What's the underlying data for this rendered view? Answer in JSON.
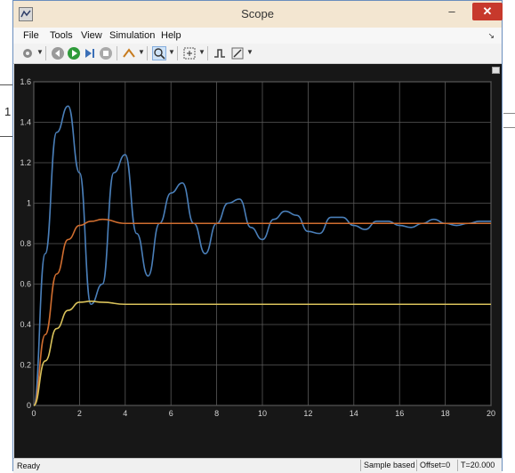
{
  "background": {
    "left_label": "1"
  },
  "window": {
    "title": "Scope",
    "minimize": "–",
    "maximize": "□",
    "close": "✕"
  },
  "menu": [
    "File",
    "Tools",
    "View",
    "Simulation",
    "Help"
  ],
  "toolbar": {
    "icons": [
      "settings-icon",
      "step-back-icon",
      "run-icon",
      "step-forward-icon",
      "stop-icon",
      "highlight-icon",
      "zoom-icon",
      "autoscale-icon",
      "triggers-icon",
      "cursor-measurements-icon"
    ]
  },
  "statusbar": {
    "status": "Ready",
    "sample_mode": "Sample based",
    "offset": "Offset=0",
    "time": "T=20.000"
  },
  "colors": {
    "plot_bg": "#000000",
    "grid": "#5a5a5a",
    "axis_text": "#d6d6d6",
    "series": [
      "#4a7fb9",
      "#cf6d2f",
      "#d9c25b"
    ]
  },
  "chart_data": {
    "type": "line",
    "xlim": [
      0,
      20
    ],
    "ylim": [
      0,
      1.6
    ],
    "xticks": [
      0,
      2,
      4,
      6,
      8,
      10,
      12,
      14,
      16,
      18,
      20
    ],
    "yticks": [
      0,
      0.2,
      0.4,
      0.6,
      0.8,
      1,
      1.2,
      1.4,
      1.6
    ],
    "ytick_labels": [
      "0",
      "0.2",
      "0.4",
      "0.6",
      "0.8",
      "1",
      "1.2",
      "1.4",
      "1.6"
    ],
    "grid": true,
    "series": [
      {
        "x": [
          0,
          0.5,
          1,
          1.5,
          2,
          2.5,
          3,
          3.5,
          4,
          4.5,
          5,
          5.5,
          6,
          6.5,
          7,
          7.5,
          8,
          8.5,
          9,
          9.5,
          10,
          10.5,
          11,
          11.5,
          12,
          12.5,
          13,
          13.5,
          14,
          14.5,
          15,
          15.5,
          16,
          16.5,
          17,
          17.5,
          18,
          18.5,
          19,
          19.5,
          20
        ],
        "y": [
          0,
          0.75,
          1.35,
          1.48,
          1.15,
          0.5,
          0.6,
          1.15,
          1.24,
          0.85,
          0.64,
          0.9,
          1.05,
          1.1,
          0.9,
          0.75,
          0.9,
          1.0,
          1.02,
          0.88,
          0.82,
          0.92,
          0.96,
          0.94,
          0.86,
          0.85,
          0.93,
          0.93,
          0.89,
          0.87,
          0.91,
          0.91,
          0.89,
          0.88,
          0.9,
          0.92,
          0.9,
          0.89,
          0.9,
          0.91,
          0.91
        ]
      },
      {
        "x": [
          0,
          0.5,
          1,
          1.5,
          2,
          2.5,
          3,
          4,
          5,
          6,
          8,
          10,
          12,
          14,
          16,
          18,
          20
        ],
        "y": [
          0,
          0.35,
          0.65,
          0.82,
          0.89,
          0.91,
          0.92,
          0.9,
          0.9,
          0.9,
          0.9,
          0.9,
          0.9,
          0.9,
          0.9,
          0.9,
          0.9
        ]
      },
      {
        "x": [
          0,
          0.5,
          1,
          1.5,
          2,
          2.5,
          3,
          4,
          5,
          6,
          8,
          10,
          12,
          14,
          16,
          18,
          20
        ],
        "y": [
          0,
          0.22,
          0.38,
          0.47,
          0.51,
          0.515,
          0.51,
          0.5,
          0.5,
          0.5,
          0.5,
          0.5,
          0.5,
          0.5,
          0.5,
          0.5,
          0.5
        ]
      }
    ]
  }
}
